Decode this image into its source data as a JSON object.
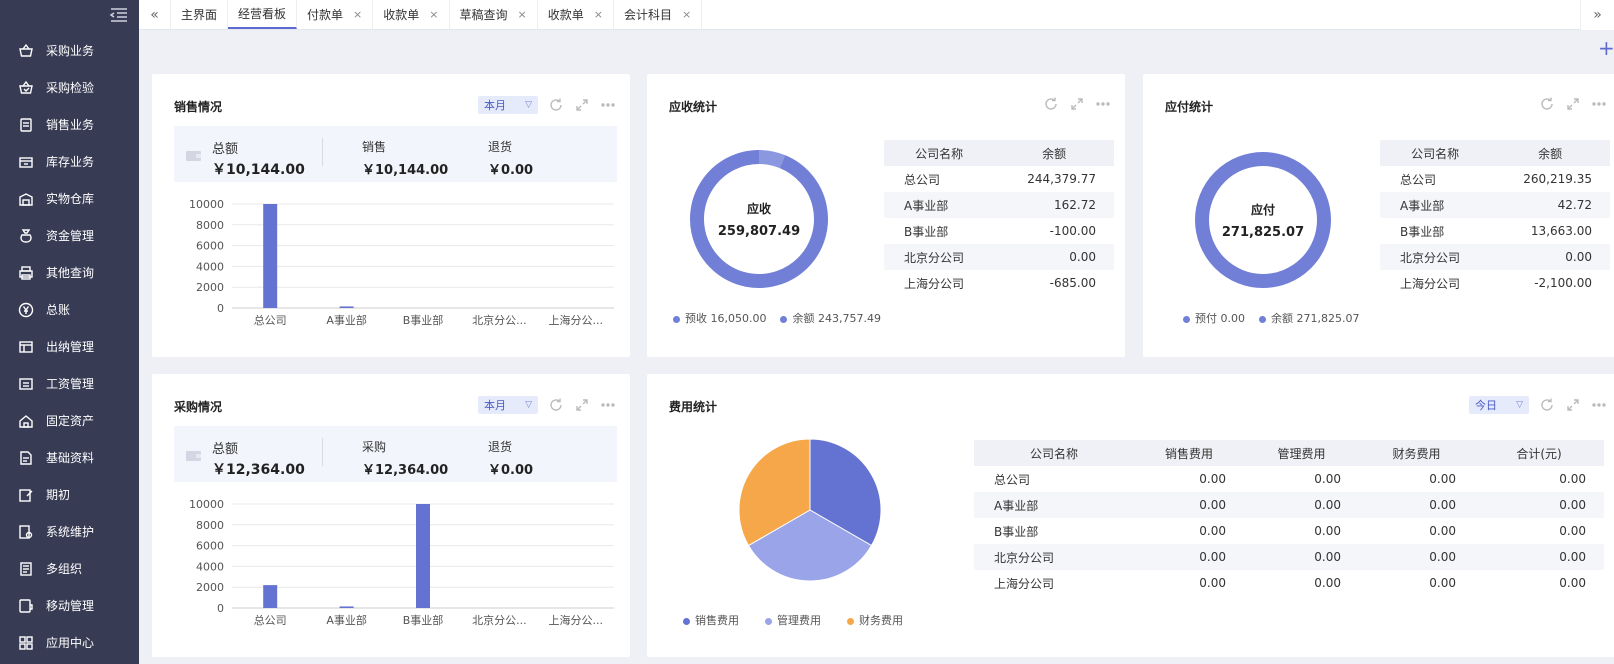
{
  "colors": {
    "sidebar": "#373b54",
    "accent": "#5b6bd1",
    "bar": "#6473d2",
    "ring": "#717fd6",
    "pie1": "#6473d2",
    "pie2": "#9aa4e8",
    "pie3": "#f5a74a"
  },
  "sidebar": {
    "items": [
      {
        "label": "采购业务",
        "icon": "basket-icon"
      },
      {
        "label": "采购检验",
        "icon": "basket-check-icon"
      },
      {
        "label": "销售业务",
        "icon": "clipboard-icon"
      },
      {
        "label": "库存业务",
        "icon": "box-icon"
      },
      {
        "label": "实物仓库",
        "icon": "warehouse-icon"
      },
      {
        "label": "资金管理",
        "icon": "moneybag-icon"
      },
      {
        "label": "其他查询",
        "icon": "printer-icon"
      },
      {
        "label": "总账",
        "icon": "yen-icon"
      },
      {
        "label": "出纳管理",
        "icon": "ledger-icon"
      },
      {
        "label": "工资管理",
        "icon": "salary-icon"
      },
      {
        "label": "固定资产",
        "icon": "house-icon"
      },
      {
        "label": "基础资料",
        "icon": "document-icon"
      },
      {
        "label": "期初",
        "icon": "edit-icon"
      },
      {
        "label": "系统维护",
        "icon": "settings-doc-icon"
      },
      {
        "label": "多组织",
        "icon": "list-icon"
      },
      {
        "label": "移动管理",
        "icon": "mobile-icon"
      },
      {
        "label": "应用中心",
        "icon": "grid-icon"
      }
    ]
  },
  "tabs": [
    {
      "label": "主界面",
      "closable": false,
      "active": false
    },
    {
      "label": "经营看板",
      "closable": false,
      "active": true
    },
    {
      "label": "付款单",
      "closable": true,
      "active": false
    },
    {
      "label": "收款单",
      "closable": true,
      "active": false
    },
    {
      "label": "草稿查询",
      "closable": true,
      "active": false
    },
    {
      "label": "收款单",
      "closable": true,
      "active": false
    },
    {
      "label": "会计科目",
      "closable": true,
      "active": false
    }
  ],
  "tab_close_glyph": "×",
  "sales": {
    "title": "销售情况",
    "period": "本月",
    "total_label": "总额",
    "total_value": "￥10,144.00",
    "a_label": "销售",
    "a_value": "￥10,144.00",
    "b_label": "退货",
    "b_value": "￥0.00"
  },
  "purchase": {
    "title": "采购情况",
    "period": "本月",
    "total_label": "总额",
    "total_value": "￥12,364.00",
    "a_label": "采购",
    "a_value": "￥12,364.00",
    "b_label": "退货",
    "b_value": "￥0.00"
  },
  "receivable": {
    "title": "应收统计",
    "center_label": "应收",
    "center_value": "259,807.49",
    "headers": [
      "公司名称",
      "余额"
    ],
    "rows": [
      [
        "总公司",
        "244,379.77"
      ],
      [
        "A事业部",
        "162.72"
      ],
      [
        "B事业部",
        "-100.00"
      ],
      [
        "北京分公司",
        "0.00"
      ],
      [
        "上海分公司",
        "-685.00"
      ]
    ],
    "legend": [
      "预收 16,050.00",
      "余额 243,757.49"
    ]
  },
  "payable": {
    "title": "应付统计",
    "center_label": "应付",
    "center_value": "271,825.07",
    "headers": [
      "公司名称",
      "余额"
    ],
    "rows": [
      [
        "总公司",
        "260,219.35"
      ],
      [
        "A事业部",
        "42.72"
      ],
      [
        "B事业部",
        "13,663.00"
      ],
      [
        "北京分公司",
        "0.00"
      ],
      [
        "上海分公司",
        "-2,100.00"
      ]
    ],
    "legend": [
      "预付 0.00",
      "余额 271,825.07"
    ]
  },
  "expense": {
    "title": "费用统计",
    "period": "今日",
    "headers": [
      "公司名称",
      "销售费用",
      "管理费用",
      "财务费用",
      "合计(元)"
    ],
    "rows": [
      [
        "总公司",
        "0.00",
        "0.00",
        "0.00",
        "0.00"
      ],
      [
        "A事业部",
        "0.00",
        "0.00",
        "0.00",
        "0.00"
      ],
      [
        "B事业部",
        "0.00",
        "0.00",
        "0.00",
        "0.00"
      ],
      [
        "北京分公司",
        "0.00",
        "0.00",
        "0.00",
        "0.00"
      ],
      [
        "上海分公司",
        "0.00",
        "0.00",
        "0.00",
        "0.00"
      ]
    ],
    "legend": [
      "销售费用",
      "管理费用",
      "财务费用"
    ]
  },
  "chart_data": [
    {
      "type": "bar",
      "categories": [
        "总公司",
        "A事业部",
        "B事业部",
        "北京分公...",
        "上海分公..."
      ],
      "values": [
        10000,
        150,
        0,
        0,
        0
      ],
      "yticks": [
        0,
        2000,
        4000,
        6000,
        8000,
        10000
      ],
      "ylim": [
        0,
        10000
      ],
      "grid": true
    },
    {
      "type": "bar",
      "categories": [
        "总公司",
        "A事业部",
        "B事业部",
        "北京分公...",
        "上海分公..."
      ],
      "values": [
        2200,
        150,
        10000,
        0,
        0
      ],
      "yticks": [
        0,
        2000,
        4000,
        6000,
        8000,
        10000
      ],
      "ylim": [
        0,
        10000
      ],
      "grid": true
    },
    {
      "type": "pie",
      "donut": true,
      "labels": [
        "预收",
        "余额"
      ],
      "values": [
        16050.0,
        243757.49
      ]
    },
    {
      "type": "pie",
      "donut": true,
      "labels": [
        "预付",
        "余额"
      ],
      "values": [
        0.0,
        271825.07
      ]
    },
    {
      "type": "pie",
      "labels": [
        "销售费用",
        "管理费用",
        "财务费用"
      ],
      "values": [
        1,
        1,
        1
      ]
    }
  ]
}
